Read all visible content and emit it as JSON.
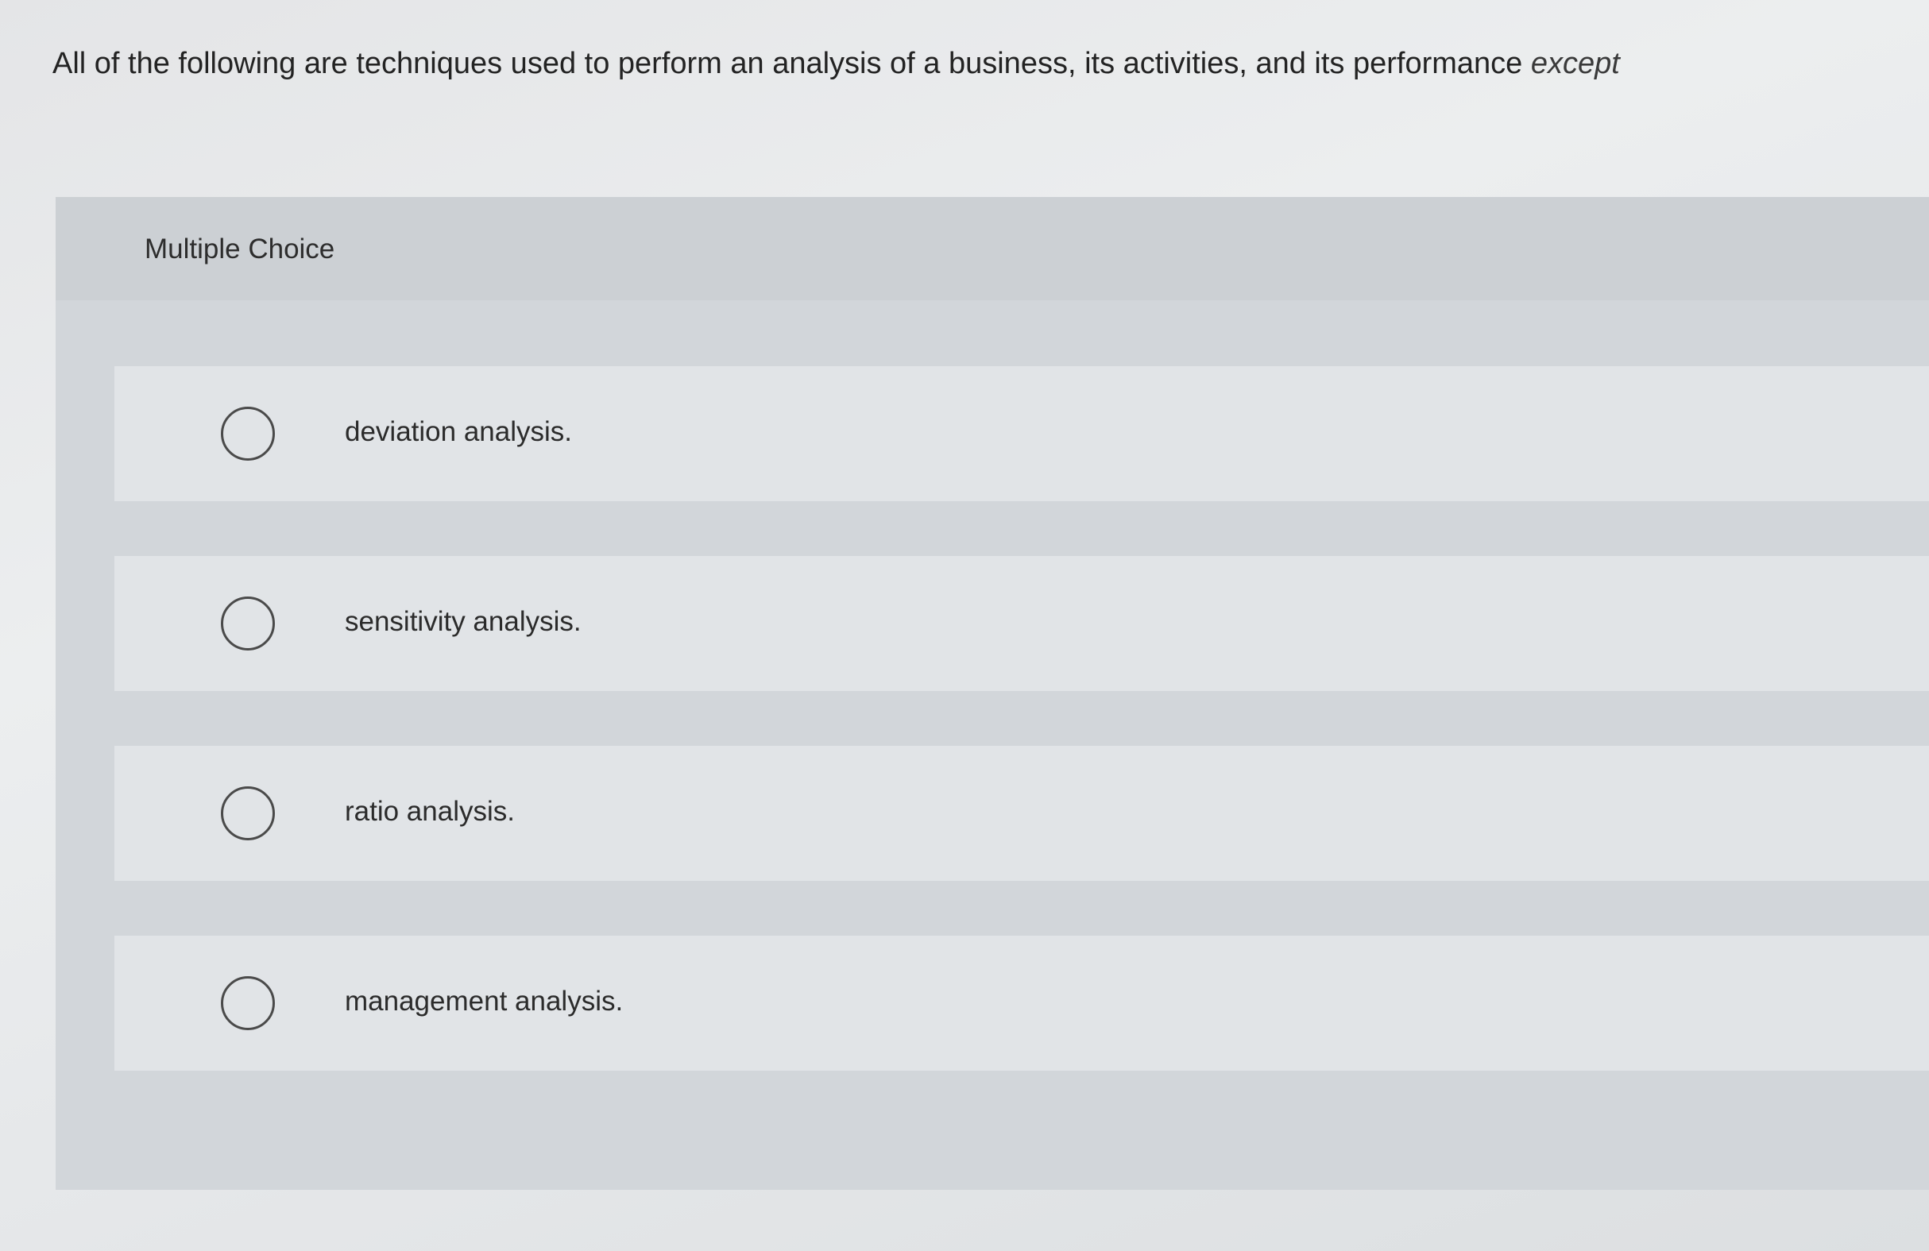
{
  "question": {
    "text": "All of the following are techniques used to perform an analysis of a business, its activities, and its performance",
    "emphasis": "except"
  },
  "panel": {
    "title": "Multiple Choice",
    "options": [
      {
        "label": "deviation analysis.",
        "selected": false
      },
      {
        "label": "sensitivity analysis.",
        "selected": false
      },
      {
        "label": "ratio analysis.",
        "selected": false
      },
      {
        "label": "management analysis.",
        "selected": false
      }
    ]
  },
  "icons": {
    "radio": "radio-unchecked-icon"
  }
}
